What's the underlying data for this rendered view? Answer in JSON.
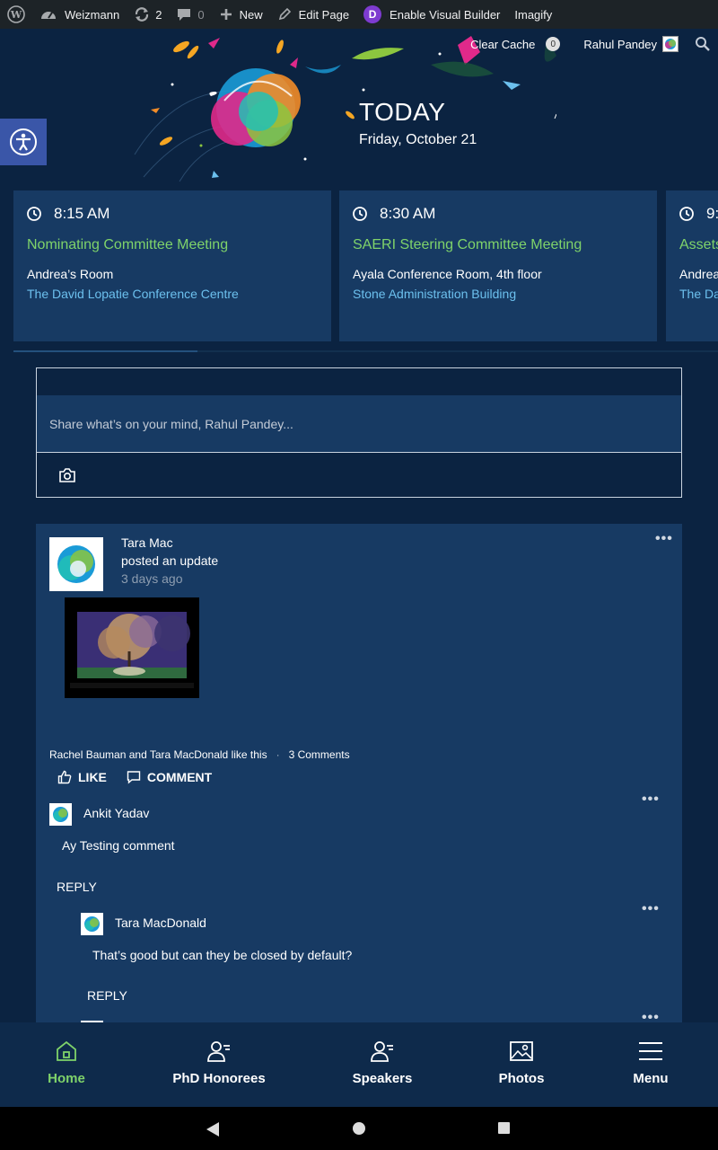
{
  "adminbar": {
    "site_name": "Weizmann",
    "updates_count": "2",
    "comments_count": "0",
    "new_label": "New",
    "edit_label": "Edit Page",
    "builder_badge": "D",
    "builder_label": "Enable Visual Builder",
    "imagify_label": "Imagify"
  },
  "hero": {
    "clear_cache_label": "Clear Cache",
    "cache_count": "0",
    "user_name": "Rahul Pandey",
    "title": "TODAY",
    "date": "Friday, October 21"
  },
  "events": [
    {
      "time": "8:15 AM",
      "title": "Nominating Committee Meeting",
      "room": "Andrea’s Room",
      "building": "The David Lopatie Conference Centre"
    },
    {
      "time": "8:30 AM",
      "title": "SAERI Steering Committee Meeting",
      "room": "Ayala Conference Room, 4th floor",
      "building": "Stone Administration Building"
    },
    {
      "time": "9:",
      "title": "Assets",
      "room": "Andrea",
      "building": "The Da"
    }
  ],
  "postbox": {
    "placeholder": "Share what’s on your mind, Rahul Pandey..."
  },
  "post": {
    "author": "Tara Mac",
    "action": "posted an update",
    "time": "3 days ago",
    "likes_text": "Rachel Bauman and Tara MacDonald like this",
    "separator": "·",
    "comments_count": "3 Comments",
    "like_label": "LIKE",
    "comment_label": "COMMENT",
    "comments": [
      {
        "name": "Ankit Yadav",
        "text": "Ay Testing comment",
        "reply_label": "REPLY"
      },
      {
        "name": "Tara MacDonald",
        "text": "That’s good but can they be closed by default?",
        "reply_label": "REPLY"
      }
    ]
  },
  "bottomnav": [
    {
      "label": "Home"
    },
    {
      "label": "PhD Honorees"
    },
    {
      "label": "Speakers"
    },
    {
      "label": "Photos"
    },
    {
      "label": "Menu"
    }
  ],
  "colors": {
    "background": "#0b2341",
    "card": "#173a63",
    "accent_green": "#7fd36a",
    "link_blue": "#6cc0ee"
  }
}
